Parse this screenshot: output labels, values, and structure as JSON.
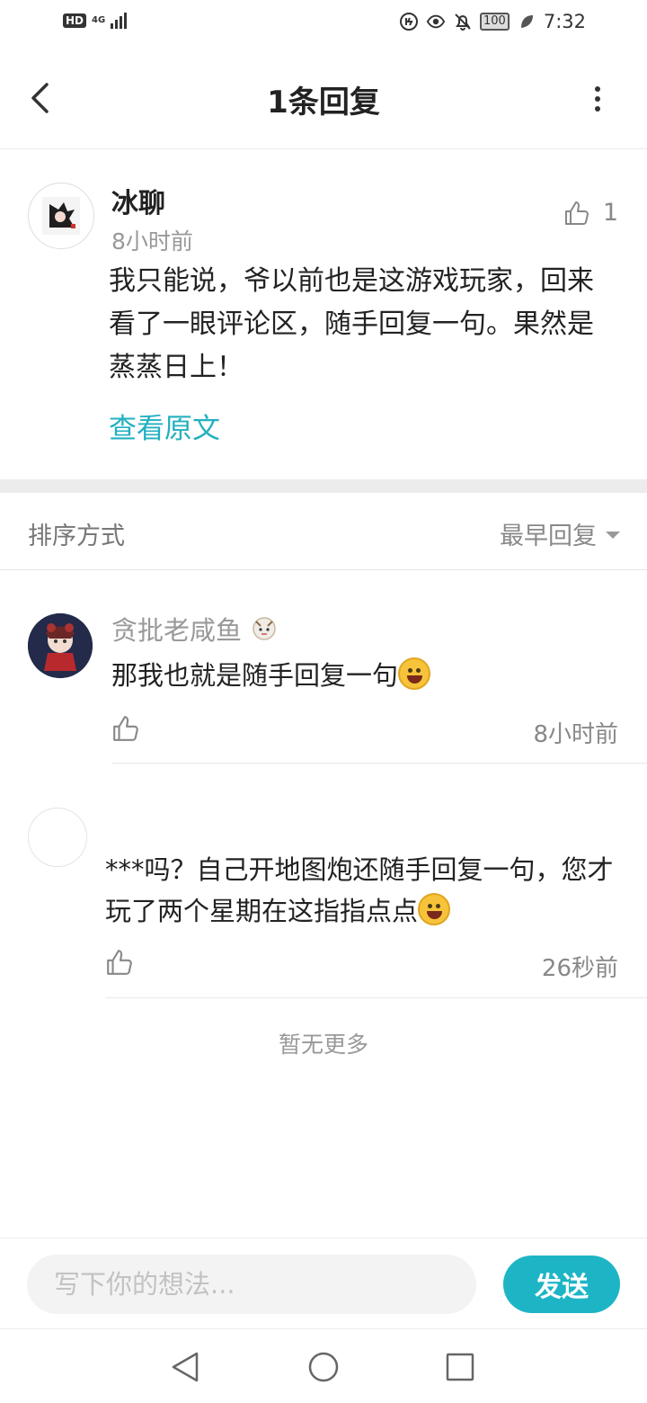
{
  "status_bar": {
    "hd": "HD",
    "network": "4G",
    "battery": "100",
    "time": "7:32"
  },
  "header": {
    "title": "1条回复"
  },
  "original_comment": {
    "author": "冰聊",
    "time": "8小时前",
    "likes": "1",
    "text": "我只能说，爷以前也是这游戏玩家，回来看了一眼评论区，随手回复一句。果然是蒸蒸日上！",
    "view_original": "查看原文"
  },
  "sort": {
    "label": "排序方式",
    "value": "最早回复"
  },
  "replies": [
    {
      "author": "贪批老咸鱼",
      "text": "那我也就是随手回复一句",
      "time": "8小时前"
    },
    {
      "author": "",
      "text": "***吗？自己开地图炮还随手回复一句，您才玩了两个星期在这指指点点",
      "time": "26秒前"
    }
  ],
  "footer_note": "暂无更多",
  "composer": {
    "placeholder": "写下你的想法...",
    "send_label": "发送"
  },
  "colors": {
    "accent": "#1db5c6",
    "link": "#23b0c0"
  }
}
